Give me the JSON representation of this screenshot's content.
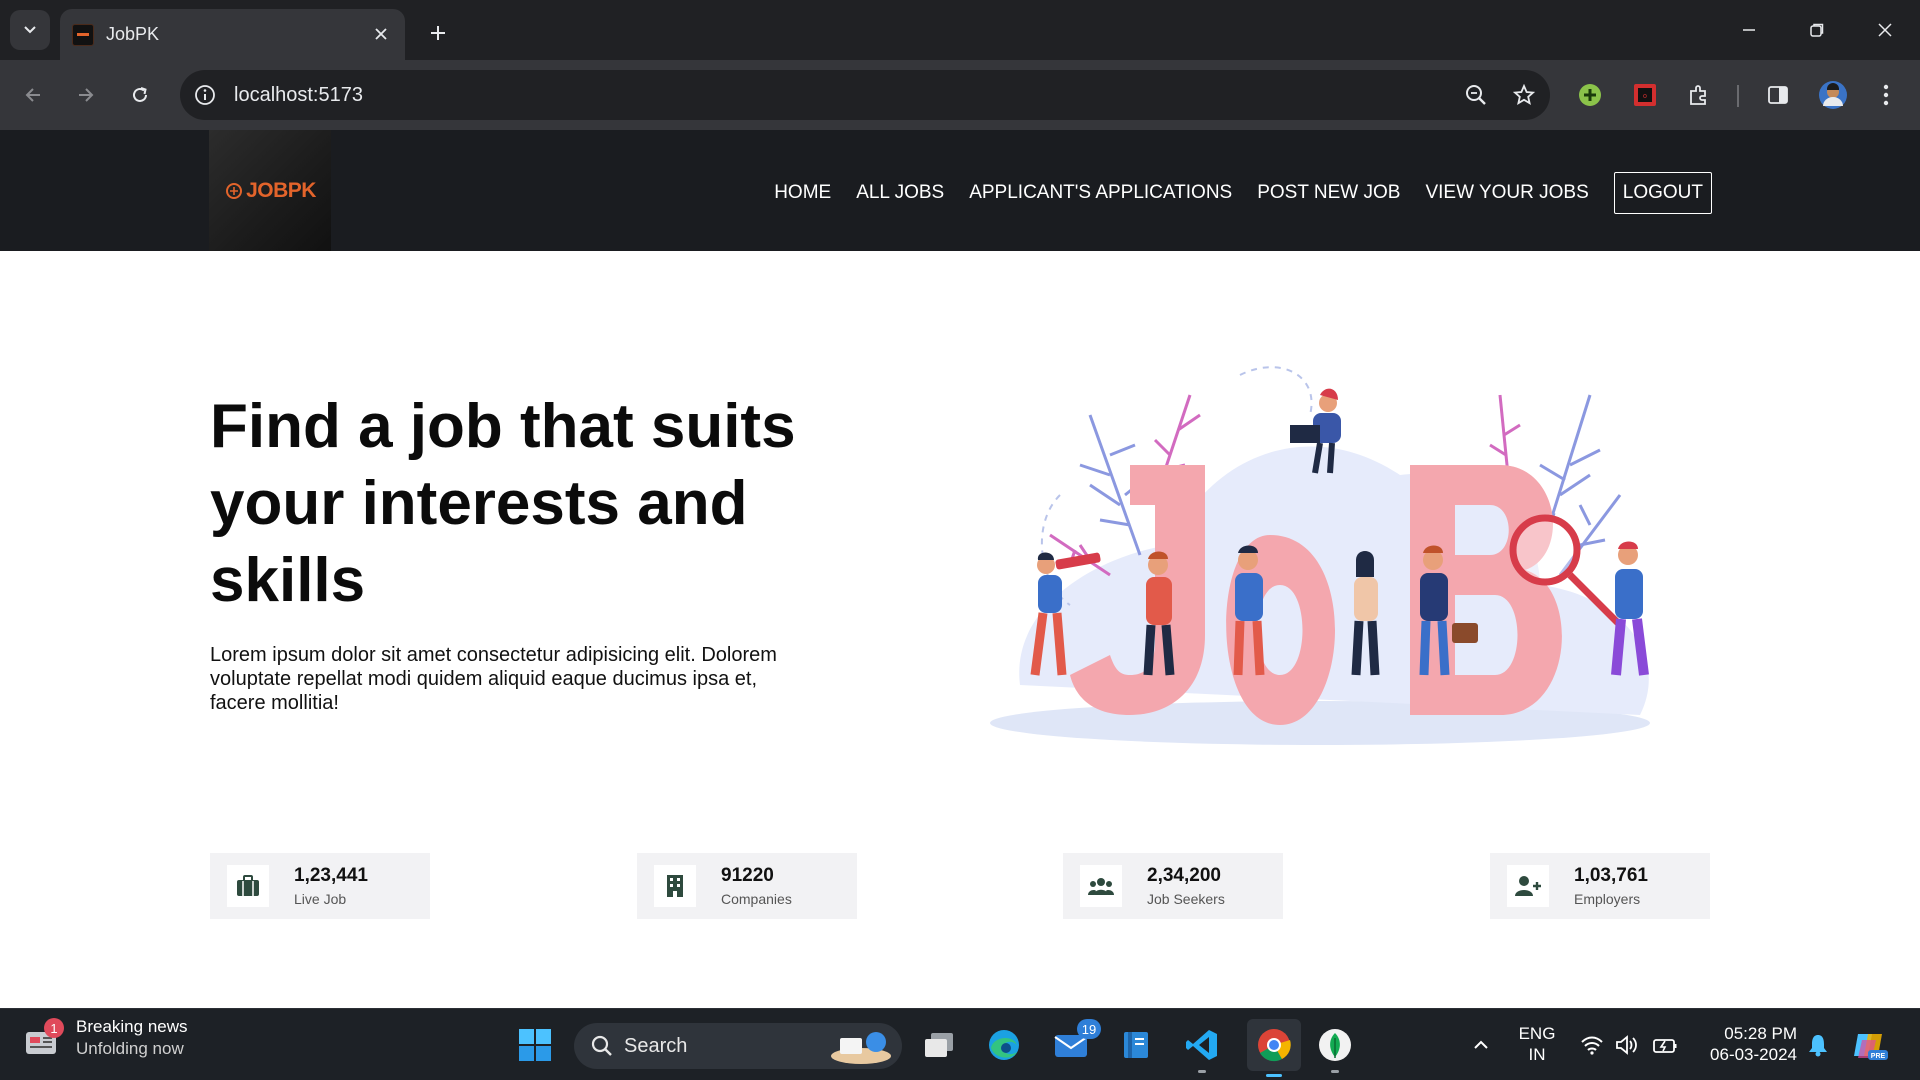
{
  "browser": {
    "tab_title": "JobPK",
    "url": "localhost:5173"
  },
  "site": {
    "logo_text": "JOBPK",
    "nav": {
      "home": "HOME",
      "all_jobs": "ALL JOBS",
      "applications": "APPLICANT'S APPLICATIONS",
      "post_job": "POST NEW JOB",
      "view_jobs": "VIEW YOUR JOBS",
      "logout": "LOGOUT"
    }
  },
  "hero": {
    "title": "Find a job that suits your interests and skills",
    "description": "Lorem ipsum dolor sit amet consectetur adipisicing elit. Dolorem voluptate repellat modi quidem aliquid eaque ducimus ipsa et, facere mollitia!",
    "illustration_word": "JOB"
  },
  "stats": [
    {
      "value": "1,23,441",
      "label": "Live Job",
      "icon": "briefcase-icon"
    },
    {
      "value": "91220",
      "label": "Companies",
      "icon": "building-icon"
    },
    {
      "value": "2,34,200",
      "label": "Job Seekers",
      "icon": "users-icon"
    },
    {
      "value": "1,03,761",
      "label": "Employers",
      "icon": "user-plus-icon"
    }
  ],
  "taskbar": {
    "news_title": "Breaking news",
    "news_subtitle": "Unfolding now",
    "news_badge": "1",
    "search_placeholder": "Search",
    "mail_badge": "19",
    "lang_line1": "ENG",
    "lang_line2": "IN",
    "time": "05:28 PM",
    "date": "06-03-2024"
  },
  "colors": {
    "header_bg": "#1a1c20",
    "logo_accent": "#e3642b",
    "stat_bg": "#f2f2f4",
    "stat_icon": "#2e4a3e"
  }
}
